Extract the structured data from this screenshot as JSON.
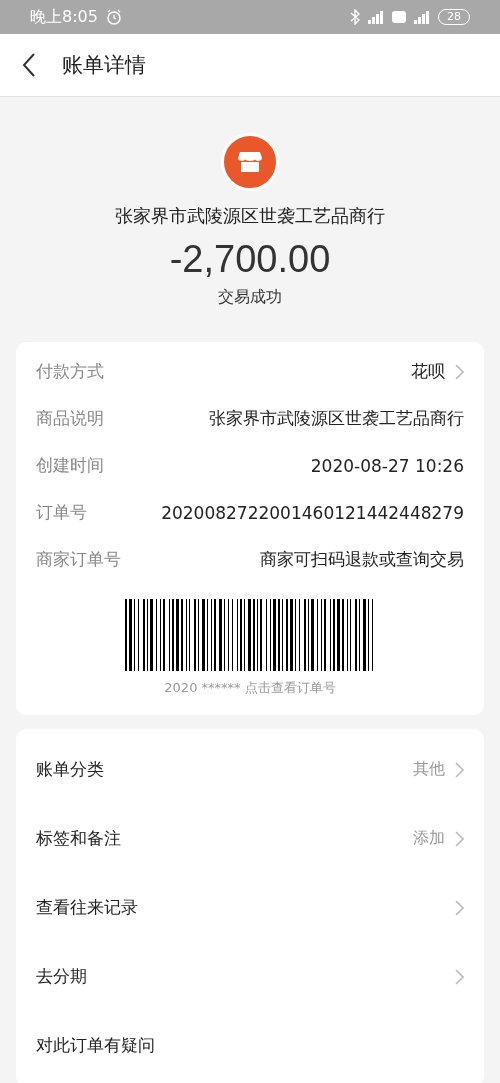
{
  "status_bar": {
    "time": "晚上8:05",
    "battery": "28"
  },
  "header": {
    "title": "账单详情"
  },
  "merchant": {
    "name": "张家界市武陵源区世袭工艺品商行",
    "amount": "-2,700.00",
    "status": "交易成功"
  },
  "details": [
    {
      "label": "付款方式",
      "value": "花呗",
      "chevron": true
    },
    {
      "label": "商品说明",
      "value": "张家界市武陵源区世袭工艺品商行",
      "chevron": false
    },
    {
      "label": "创建时间",
      "value": "2020-08-27 10:26",
      "chevron": false
    },
    {
      "label": "订单号",
      "value": "2020082722001460121442448279",
      "chevron": false
    },
    {
      "label": "商家订单号",
      "value": "商家可扫码退款或查询交易",
      "chevron": false
    }
  ],
  "barcode": {
    "caption": "2020 ****** 点击查看订单号"
  },
  "actions": [
    {
      "label": "账单分类",
      "value": "其他",
      "chevron": true
    },
    {
      "label": "标签和备注",
      "value": "添加",
      "chevron": true
    },
    {
      "label": "查看往来记录",
      "chevron": true
    },
    {
      "label": "去分期",
      "chevron": true
    },
    {
      "label": "对此订单有疑问",
      "chevron": false
    }
  ]
}
